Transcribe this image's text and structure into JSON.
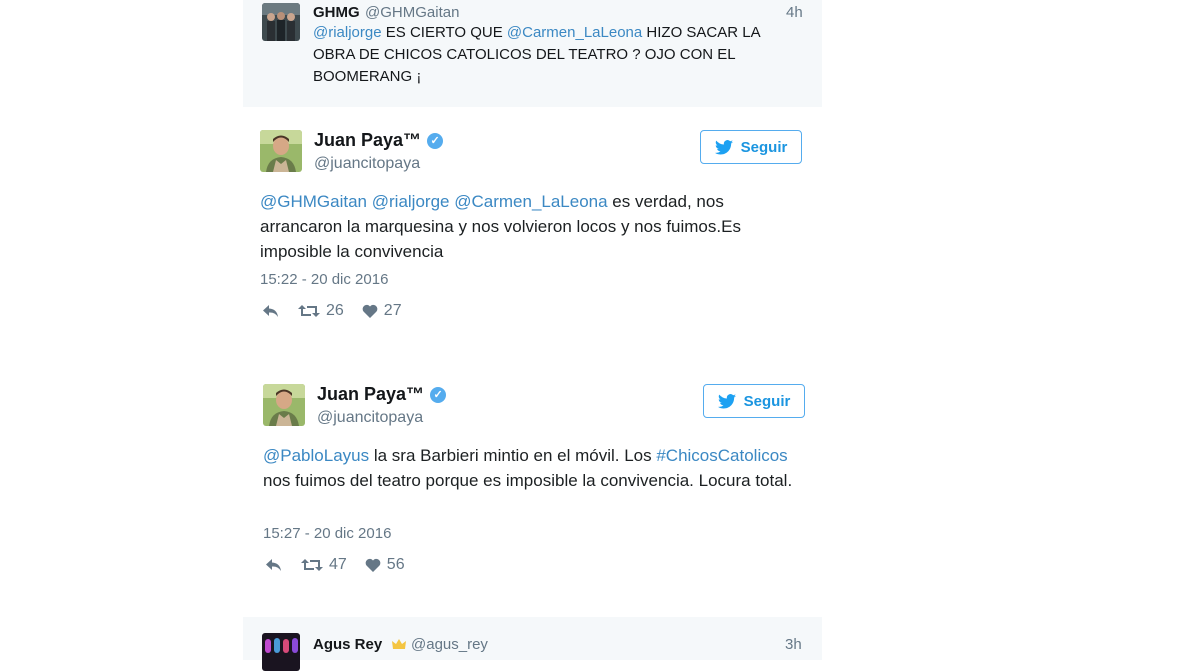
{
  "top_quote": {
    "name": "GHMG",
    "handle": "@GHMGaitan",
    "time": "4h",
    "mention1": "@rialjorge",
    "text1": " ES CIERTO QUE ",
    "mention2": "@Carmen_LaLeona",
    "text2": " HIZO SACAR LA OBRA DE CHICOS CATOLICOS DEL TEATRO ? OJO CON EL BOOMERANG ¡"
  },
  "tweet1": {
    "name": "Juan Paya™",
    "handle": "@juancitopaya",
    "follow_label": "Seguir",
    "mention1": "@GHMGaitan",
    "mention2": "@rialjorge",
    "mention3": "@Carmen_LaLeona",
    "text": " es verdad, nos arrancaron la marquesina y nos volvieron locos y nos fuimos.Es imposible la convivencia",
    "date": "15:22 - 20 dic 2016",
    "retweets": "26",
    "likes": "27"
  },
  "tweet2": {
    "name": "Juan Paya™",
    "handle": "@juancitopaya",
    "follow_label": "Seguir",
    "mention1": "@PabloLayus",
    "text1": " la sra Barbieri mintio en el móvil. Los ",
    "hashtag": "#ChicosCatolicos",
    "text2": " nos fuimos del teatro porque es imposible la convivencia. Locura total.",
    "date": "15:27 - 20 dic 2016",
    "retweets": "47",
    "likes": "56"
  },
  "bottom_quote": {
    "name": "Agus Rey",
    "handle": "@agus_rey",
    "time": "3h"
  },
  "colors": {
    "link": "#3b88c3",
    "follow_border": "#55acee",
    "muted": "#657786"
  }
}
